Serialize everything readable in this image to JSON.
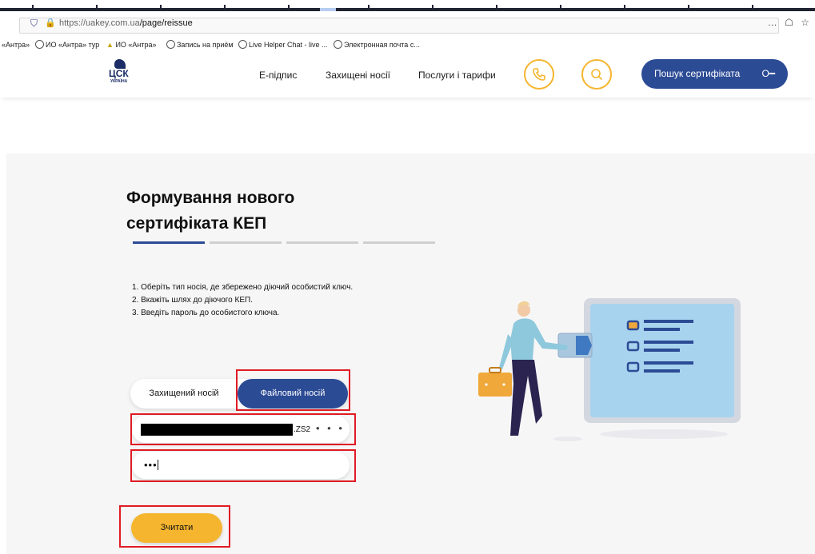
{
  "browser": {
    "url_host": "https://uakey.com.ua",
    "url_path": "/page/reissue",
    "more_icon": "…",
    "pocket_icon": "pocket-icon",
    "bookmarks": [
      "«Антра»",
      "ИО «Антра» тур",
      "ИО «Антра»",
      "Запись на приём",
      "Live Helper Chat - live ...",
      "Электронная почта с..."
    ]
  },
  "header": {
    "logo_text": "ЦСК",
    "logo_sub": "УКРАЇНА",
    "nav": [
      "Е-підпис",
      "Захищені носії",
      "Послуги і тарифи"
    ],
    "search_cert_label": "Пошук сертифіката",
    "key_icon": "key-icon"
  },
  "main": {
    "title_line1": "Формування нового",
    "title_line2": "сертифіката КЕП",
    "steps_total": 4,
    "steps_active": 1,
    "instructions": [
      "1. Оберіть тип носія, де збережено діючий особистий ключ.",
      "2. Вкажіть шлях до діючого КЕП.",
      "3. Введіть пароль до особистого ключа."
    ],
    "toggle_left": "Захищений носій",
    "toggle_right": "Файловий носій",
    "file_ext": ".ZS2",
    "file_dots": "• • •",
    "password_value": "•••",
    "read_button": "Зчитати"
  },
  "colors": {
    "primary": "#2c4b95",
    "accent": "#f5b52f",
    "highlight": "#e01b24"
  }
}
